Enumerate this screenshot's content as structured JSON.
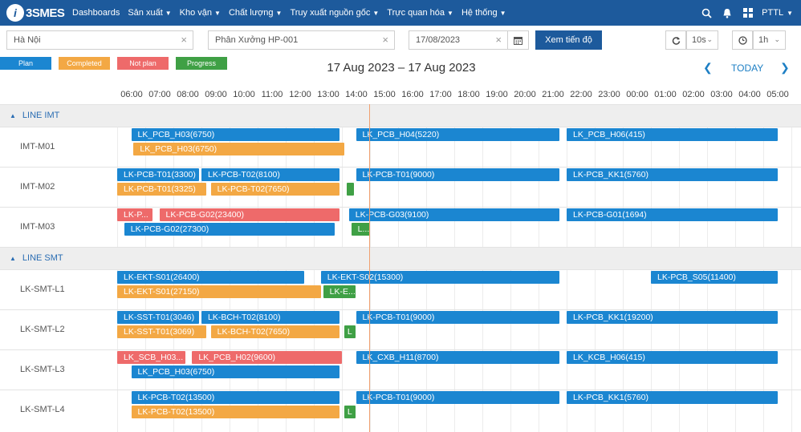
{
  "app": {
    "logo_letter": "i",
    "logo_text": "3SMES"
  },
  "nav": [
    {
      "label": "Dashboards",
      "caret": false
    },
    {
      "label": "Sản xuất",
      "caret": true
    },
    {
      "label": "Kho vận",
      "caret": true
    },
    {
      "label": "Chất lượng",
      "caret": true
    },
    {
      "label": "Truy xuất nguồn gốc",
      "caret": true
    },
    {
      "label": "Trực quan hóa",
      "caret": true
    },
    {
      "label": "Hệ thống",
      "caret": true
    }
  ],
  "user": {
    "name": "PTTL"
  },
  "filters": {
    "location": "Hà Nội",
    "workshop": "Phân Xưởng HP-001",
    "date": "17/08/2023",
    "view_button": "Xem tiến độ",
    "refresh_interval": "10s",
    "time_scale": "1h"
  },
  "legend": [
    {
      "label": "Plan",
      "color": "#1b86d1"
    },
    {
      "label": "Completed",
      "color": "#f3a844"
    },
    {
      "label": "Not plan",
      "color": "#ee6a6a"
    },
    {
      "label": "Progress",
      "color": "#3fa045"
    }
  ],
  "range_title": "17 Aug 2023 – 17 Aug 2023",
  "today_label": "TODAY",
  "hours": [
    "06:00",
    "07:00",
    "08:00",
    "09:00",
    "10:00",
    "11:00",
    "12:00",
    "13:00",
    "14:00",
    "15:00",
    "16:00",
    "17:00",
    "18:00",
    "19:00",
    "20:00",
    "21:00",
    "22:00",
    "23:00",
    "00:00",
    "01:00",
    "02:00",
    "03:00",
    "04:00",
    "05:00"
  ],
  "groups": [
    {
      "label": "LINE IMT",
      "machines": [
        {
          "name": "IMT-M01",
          "bars": [
            {
              "type": "plan",
              "label": "LK_PCB_H03(6750)",
              "start": "06:30",
              "end": "13:55",
              "lane": 0
            },
            {
              "type": "completed",
              "label": "LK_PCB_H03(6750)",
              "start": "06:35",
              "end": "14:05",
              "lane": 1
            },
            {
              "type": "plan",
              "label": "LK_PCB_H04(5220)",
              "start": "14:30",
              "end": "21:45",
              "lane": 0
            },
            {
              "type": "plan",
              "label": "LK_PCB_H06(415)",
              "start": "22:00",
              "end": "05:30",
              "lane": 0
            }
          ]
        },
        {
          "name": "IMT-M02",
          "bars": [
            {
              "type": "plan",
              "label": "LK-PCB-T01(3300)",
              "start": "06:00",
              "end": "08:55",
              "lane": 0
            },
            {
              "type": "plan",
              "label": "LK-PCB-T02(8100)",
              "start": "09:00",
              "end": "13:55",
              "lane": 0
            },
            {
              "type": "completed",
              "label": "LK-PCB-T01(3325)",
              "start": "06:00",
              "end": "09:10",
              "lane": 1
            },
            {
              "type": "completed",
              "label": "LK-PCB-T02(7650)",
              "start": "09:20",
              "end": "13:55",
              "lane": 1
            },
            {
              "type": "progress",
              "label": "",
              "start": "14:10",
              "end": "14:25",
              "lane": 1
            },
            {
              "type": "plan",
              "label": "LK-PCB-T01(9000)",
              "start": "14:30",
              "end": "21:45",
              "lane": 0
            },
            {
              "type": "plan",
              "label": "LK-PCB_KK1(5760)",
              "start": "22:00",
              "end": "05:30",
              "lane": 0
            }
          ]
        },
        {
          "name": "IMT-M03",
          "bars": [
            {
              "type": "notplan",
              "label": "LK-P...",
              "start": "06:00",
              "end": "07:15",
              "lane": 0
            },
            {
              "type": "notplan",
              "label": "LK-PCB-G02(23400)",
              "start": "07:30",
              "end": "13:55",
              "lane": 0
            },
            {
              "type": "plan",
              "label": "LK-PCB-G02(27300)",
              "start": "06:15",
              "end": "13:45",
              "lane": 1
            },
            {
              "type": "plan",
              "label": "LK-PCB-G03(9100)",
              "start": "14:15",
              "end": "21:45",
              "lane": 0
            },
            {
              "type": "progress",
              "label": "L...",
              "start": "14:20",
              "end": "15:00",
              "lane": 1
            },
            {
              "type": "plan",
              "label": "LK-PCB-G01(1694)",
              "start": "22:00",
              "end": "05:30",
              "lane": 0
            }
          ]
        }
      ]
    },
    {
      "label": "LINE SMT",
      "machines": [
        {
          "name": "LK-SMT-L1",
          "bars": [
            {
              "type": "plan",
              "label": "LK-EKT-S01(26400)",
              "start": "06:00",
              "end": "12:40",
              "lane": 0
            },
            {
              "type": "completed",
              "label": "LK-EKT-S01(27150)",
              "start": "06:00",
              "end": "13:15",
              "lane": 1
            },
            {
              "type": "plan",
              "label": "LK-EKT-S02(15300)",
              "start": "13:15",
              "end": "21:45",
              "lane": 0
            },
            {
              "type": "progress",
              "label": "LK-E...",
              "start": "13:20",
              "end": "14:30",
              "lane": 1
            },
            {
              "type": "plan",
              "label": "LK-PCB_S05(11400)",
              "start": "01:00",
              "end": "05:30",
              "lane": 0
            }
          ]
        },
        {
          "name": "LK-SMT-L2",
          "bars": [
            {
              "type": "plan",
              "label": "LK-SST-T01(3046)",
              "start": "06:00",
              "end": "08:55",
              "lane": 0
            },
            {
              "type": "plan",
              "label": "LK-BCH-T02(8100)",
              "start": "09:00",
              "end": "13:55",
              "lane": 0
            },
            {
              "type": "completed",
              "label": "LK-SST-T01(3069)",
              "start": "06:00",
              "end": "09:10",
              "lane": 1
            },
            {
              "type": "completed",
              "label": "LK-BCH-T02(7650)",
              "start": "09:20",
              "end": "13:55",
              "lane": 1
            },
            {
              "type": "progress",
              "label": "L",
              "start": "14:05",
              "end": "14:30",
              "lane": 1
            },
            {
              "type": "plan",
              "label": "LK-PCB-T01(9000)",
              "start": "14:30",
              "end": "21:45",
              "lane": 0
            },
            {
              "type": "plan",
              "label": "LK-PCB_KK1(19200)",
              "start": "22:00",
              "end": "05:30",
              "lane": 0
            }
          ]
        },
        {
          "name": "LK-SMT-L3",
          "bars": [
            {
              "type": "notplan",
              "label": "LK_SCB_H03...",
              "start": "06:00",
              "end": "08:25",
              "lane": 0
            },
            {
              "type": "notplan",
              "label": "LK_PCB_H02(9600)",
              "start": "08:40",
              "end": "14:00",
              "lane": 0
            },
            {
              "type": "plan",
              "label": "LK_PCB_H03(6750)",
              "start": "06:30",
              "end": "13:55",
              "lane": 1
            },
            {
              "type": "plan",
              "label": "LK_CXB_H11(8700)",
              "start": "14:30",
              "end": "21:45",
              "lane": 0
            },
            {
              "type": "plan",
              "label": "LK_KCB_H06(415)",
              "start": "22:00",
              "end": "05:30",
              "lane": 0
            }
          ]
        },
        {
          "name": "LK-SMT-L4",
          "bars": [
            {
              "type": "plan",
              "label": "LK-PCB-T02(13500)",
              "start": "06:30",
              "end": "13:55",
              "lane": 0
            },
            {
              "type": "completed",
              "label": "LK-PCB-T02(13500)",
              "start": "06:30",
              "end": "13:55",
              "lane": 1
            },
            {
              "type": "progress",
              "label": "L",
              "start": "14:05",
              "end": "14:30",
              "lane": 1
            },
            {
              "type": "plan",
              "label": "LK-PCB-T01(9000)",
              "start": "14:30",
              "end": "21:45",
              "lane": 0
            },
            {
              "type": "plan",
              "label": "LK-PCB_KK1(5760)",
              "start": "22:00",
              "end": "05:30",
              "lane": 0
            }
          ]
        }
      ]
    }
  ]
}
